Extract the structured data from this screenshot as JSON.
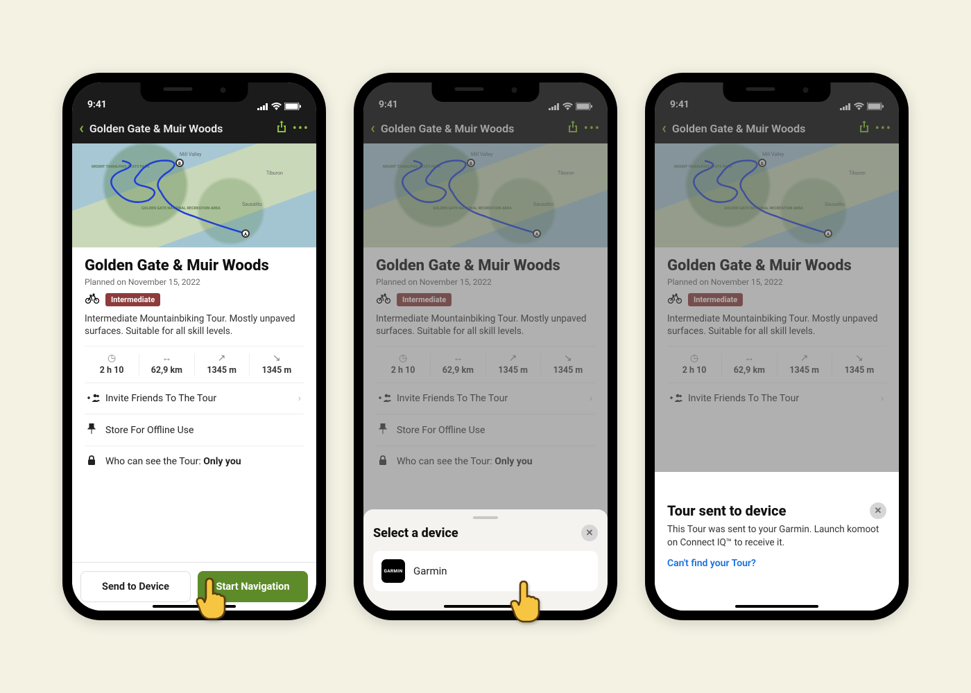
{
  "status": {
    "time": "9:41"
  },
  "nav": {
    "title": "Golden Gate & Muir Woods"
  },
  "tour": {
    "title": "Golden Gate & Muir Woods",
    "planned": "Planned on November 15, 2022",
    "badge": "Intermediate",
    "description": "Intermediate Mountainbiking Tour. Mostly unpaved surfaces. Suitable for all skill levels."
  },
  "stats": {
    "duration": "2 h 10",
    "distance": "62,9 km",
    "ascent": "1345 m",
    "descent": "1345 m"
  },
  "list": {
    "invite": "Invite Friends To The Tour",
    "offline": "Store For Offline Use",
    "privacy_prefix": "Who can see the Tour: ",
    "privacy_value": "Only you"
  },
  "buttons": {
    "send": "Send to Device",
    "start": "Start Navigation"
  },
  "sheet": {
    "title": "Select a device",
    "device": "Garmin",
    "device_brand": "GARMIN"
  },
  "toast": {
    "title": "Tour sent to device",
    "body": "This Tour was sent to your Garmin. Launch komoot on Connect IQ™ to receive it.",
    "link": "Can't find your Tour?"
  },
  "map_labels": {
    "mill_valley": "Mill Valley",
    "tiburon": "Tiburon",
    "sausalito": "Sausalito",
    "tamalpais": "MOUNT TAMALPAIS STATE PARK",
    "ggnra": "GOLDEN GATE NATIONAL RECREATION AREA"
  }
}
